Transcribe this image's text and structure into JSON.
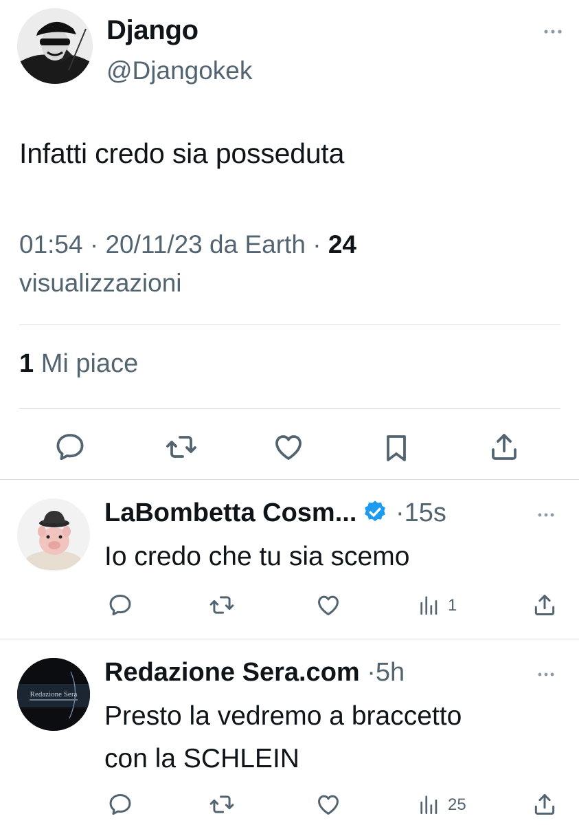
{
  "main_tweet": {
    "author_name": "Django",
    "author_handle": "@Djangokek",
    "text": "Infatti credo sia posseduta",
    "time": "01:54",
    "date": "20/11/23",
    "source": "da Earth",
    "views_count": "24",
    "views_label": "visualizzazioni",
    "likes_count": "1",
    "likes_label": "Mi piace"
  },
  "replies": [
    {
      "author_name": "LaBombetta Cosm...",
      "verified": true,
      "time": "15s",
      "text": "Io credo che tu sia scemo",
      "views_count": "1"
    },
    {
      "author_name": "Redazione Sera.com",
      "verified": false,
      "time": "5h",
      "text_line1": "Presto la vedremo a braccetto",
      "text_line2": "con la SCHLEIN",
      "views_count": "25",
      "avatar_text": "Redazione Sera"
    }
  ],
  "colors": {
    "text": "#0f1419",
    "secondary": "#536471",
    "divider": "#d9dde1",
    "verified": "#1d9bf0"
  },
  "icons": [
    "more-icon",
    "reply-icon",
    "retweet-icon",
    "like-icon",
    "bookmark-icon",
    "share-icon",
    "views-icon",
    "verified-icon"
  ]
}
